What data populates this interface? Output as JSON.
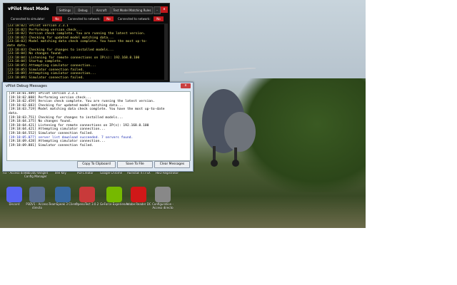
{
  "host_window": {
    "title": "vPilot Host Mode",
    "buttons": [
      "Settings",
      "Debug",
      "Aircraft",
      "Test Model Matching Rules"
    ],
    "minimize": "–",
    "close": "x",
    "status": [
      {
        "label": "Connected to simulator:",
        "value": "No"
      },
      {
        "label": "Connected to network:",
        "value": "No"
      },
      {
        "label": "Connected to network:",
        "value": "No"
      }
    ],
    "console_lines": [
      "[23:18:02] vPilot version 2.3.1",
      "[23:18:02] Performing version check...",
      "[23:18:02] Version check complete. You are running the latest version.",
      "[23:18:02] Checking for updated model matching data...",
      "[23:18:03] Model matching data check complete. You have the most up-to-",
      "date data.",
      "[23:18:03] Checking for changes to installed models...",
      "[23:18:04] No changes found.",
      "[23:18:04] Listening for remote connections on IP(s): 192.168.0.100",
      "[23:18:04] Startup complete.",
      "[23:18:05] Attempting simulator connection...",
      "[23:18:05] Simulator connection failed.",
      "[23:18:09] Attempting simulator connection...",
      "[23:18:09] Simulator connection failed."
    ]
  },
  "debug_window": {
    "title": "vPilot Debug Messages",
    "close": "x",
    "lines": [
      {
        "text": "[19:18:01.489] vPilot version 2.3.1",
        "blue": false
      },
      {
        "text": "[19:18:02.088] Performing version check...",
        "blue": false
      },
      {
        "text": "[19:18:02.459] Version check complete. You are running the latest version.",
        "blue": false
      },
      {
        "text": "[19:18:02.683] Checking for updated model matching data...",
        "blue": false
      },
      {
        "text": "[19:18:03.719] Model matching data check complete. You have the most up-to-date",
        "blue": false
      },
      {
        "text": "data.",
        "blue": false
      },
      {
        "text": "[19:18:03.751] Checking for changes to installed models...",
        "blue": false
      },
      {
        "text": "[19:18:04.375] No changes found.",
        "blue": false
      },
      {
        "text": "[19:18:04.421] Listening for remote connections on IP(s): 192.168.0.100",
        "blue": false
      },
      {
        "text": "[19:18:04.421] Attempting simulator connection...",
        "blue": false
      },
      {
        "text": "[19:18:04.552] Simulator connection failed.",
        "blue": false
      },
      {
        "text": "[19:18:05.077] server list download succeeded. 7 servers found.",
        "blue": true
      },
      {
        "text": "[19:18:09.428] Attempting simulator connection...",
        "blue": false
      },
      {
        "text": "[19:18:09.881] Simulator connection failed.",
        "blue": false
      }
    ],
    "buttons": [
      "Copy To Clipboard",
      "Save To File",
      "Clear Messages"
    ]
  },
  "desktop": {
    "top_labels": [
      "Fix - Acceso directo",
      "767-300 Winglet Config Manager",
      "Tree Key",
      "PDFCreator",
      "Google Chrome",
      "AEInstall V7.FSX",
      "HEO Registrator"
    ],
    "icons": [
      {
        "label": "Discord",
        "icon": "discord-icon",
        "color": "#5865f2"
      },
      {
        "label": "P3DV1 - Acceso directo",
        "icon": "p3d-icon",
        "color": "#5a6e90"
      },
      {
        "label": "TeamSpeak 3 Client",
        "icon": "teamspeak-icon",
        "color": "#3a6aa0"
      },
      {
        "label": "OpenoTect 3.0.2",
        "icon": "opentect-icon",
        "color": "#c83a3a"
      },
      {
        "label": "GeForce Experience",
        "icon": "geforce-icon",
        "color": "#76b900"
      },
      {
        "label": "Adobe Reader DC",
        "icon": "adobe-reader-icon",
        "color": "#d01818"
      },
      {
        "label": "Configuration - Acceso directo",
        "icon": "airplane-icon",
        "color": "#888888"
      }
    ]
  }
}
